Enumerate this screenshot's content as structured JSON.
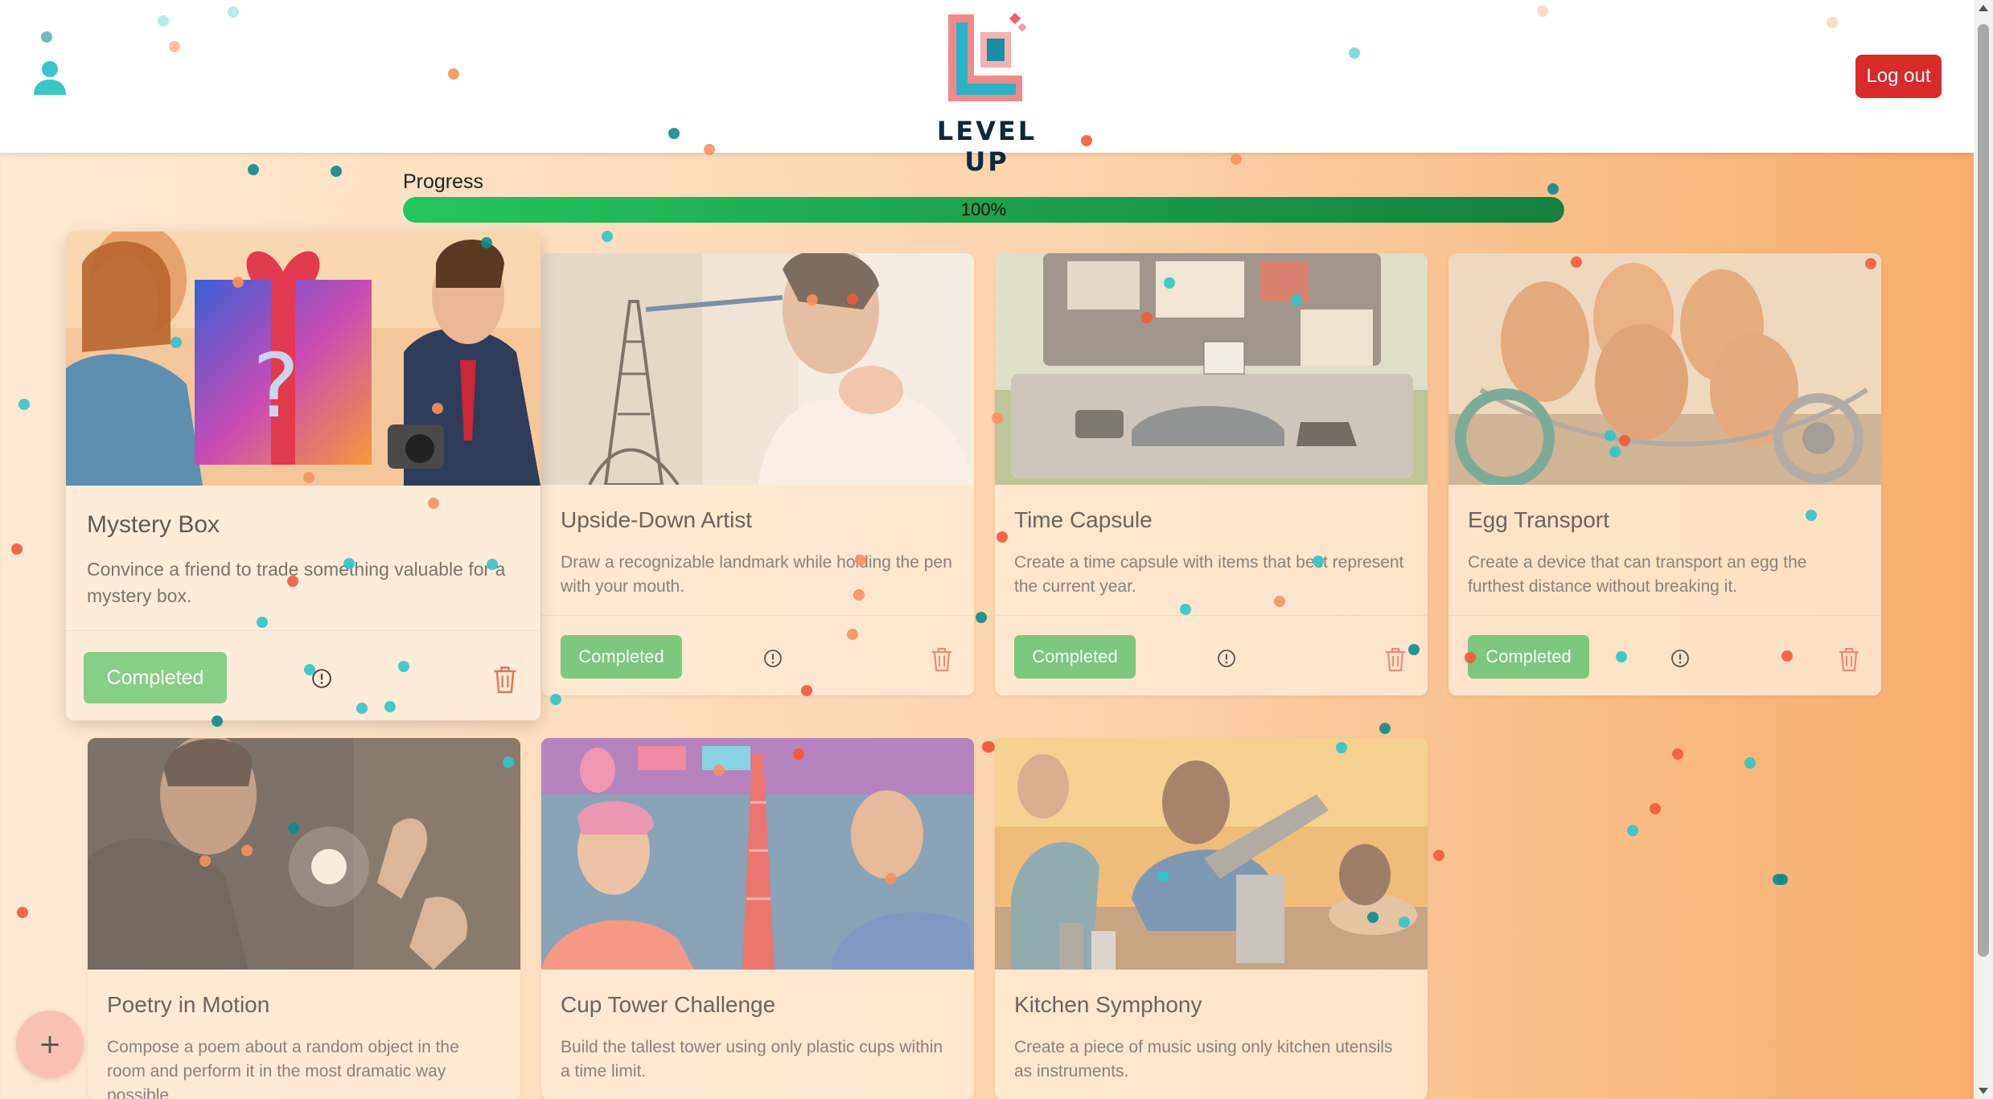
{
  "header": {
    "logo_text": "LEVEL UP",
    "logout_label": "Log out",
    "user_icon": "user-icon"
  },
  "progress": {
    "label": "Progress",
    "value": 100,
    "text": "100%"
  },
  "cards": [
    {
      "title": "Mystery Box",
      "description": "Convince a friend to trade something valuable for a mystery box.",
      "status_label": "Completed"
    },
    {
      "title": "Upside-Down Artist",
      "description": "Draw a recognizable landmark while holding the pen with your mouth.",
      "status_label": "Completed"
    },
    {
      "title": "Time Capsule",
      "description": "Create a time capsule with items that best represent the current year.",
      "status_label": "Completed"
    },
    {
      "title": "Egg Transport",
      "description": "Create a device that can transport an egg the furthest distance without breaking it.",
      "status_label": "Completed"
    },
    {
      "title": "Poetry in Motion",
      "description": "Compose a poem about a random object in the room and perform it in the most dramatic way possible."
    },
    {
      "title": "Cup Tower Challenge",
      "description": "Build the tallest tower using only plastic cups within a time limit."
    },
    {
      "title": "Kitchen Symphony",
      "description": "Create a piece of music using only kitchen utensils as instruments."
    }
  ],
  "fab": {
    "label": "+"
  },
  "colors": {
    "accent": "#d92a2a",
    "completed": "#7cc87c",
    "progress_start": "#22c55e",
    "progress_end": "#15803d",
    "confetti": [
      "#0e8a8a",
      "#2cc6c6",
      "#f6925e",
      "#f25a3a",
      "#0a6e6e"
    ]
  }
}
